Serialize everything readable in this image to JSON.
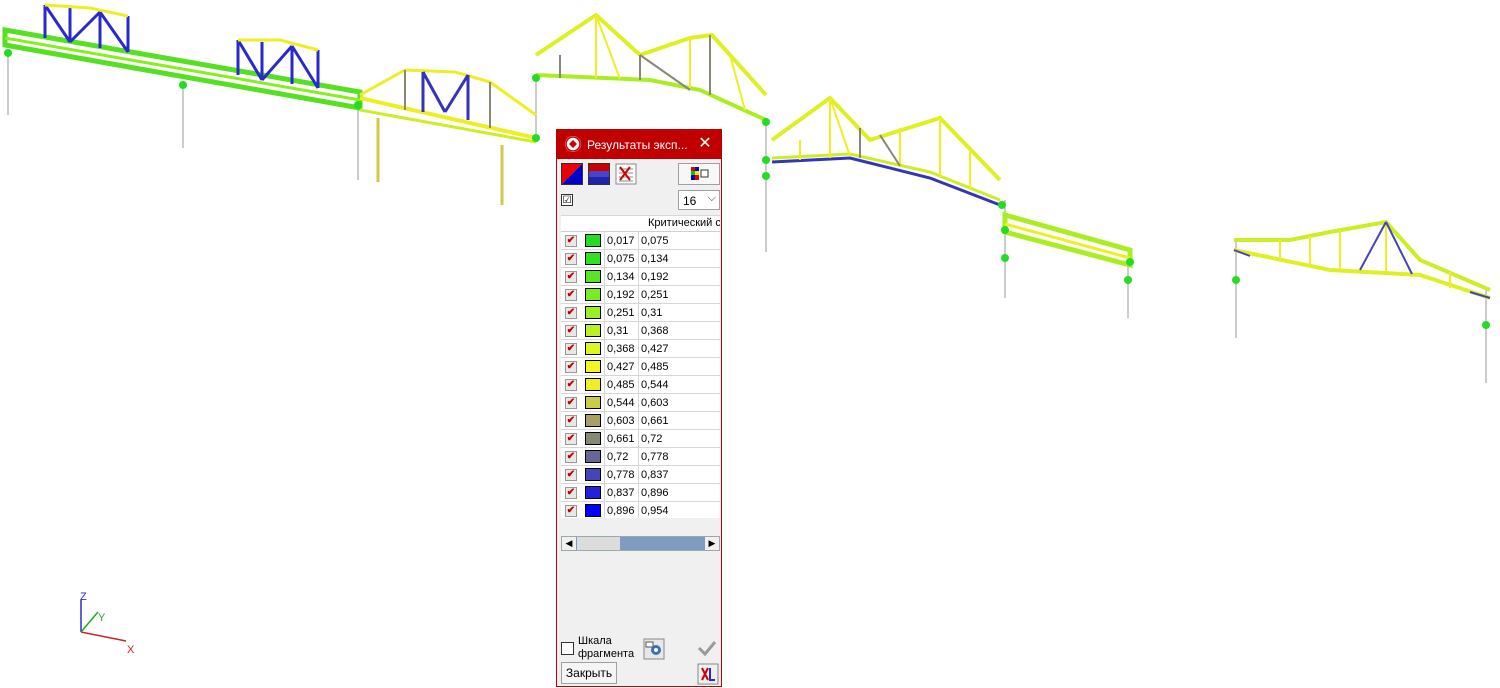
{
  "axes": {
    "x": "X",
    "y": "Y",
    "z": "Z"
  },
  "dialog": {
    "title": "Результаты эксп...",
    "column_header": "Критический с",
    "count_value": "16",
    "check_mark": "☑",
    "scale_label_line1": "Шкала",
    "scale_label_line2": "фрагмента",
    "close_button": "Закрыть",
    "scroll_left": "◀",
    "scroll_right": "▶",
    "dropdown_arrow": "⌵",
    "row_check": "✔",
    "rows": [
      {
        "from": "0,017",
        "to": "0,075",
        "color": "#22dd22"
      },
      {
        "from": "0,075",
        "to": "0,134",
        "color": "#33e022"
      },
      {
        "from": "0,134",
        "to": "0,192",
        "color": "#55e822"
      },
      {
        "from": "0,192",
        "to": "0,251",
        "color": "#77ee22"
      },
      {
        "from": "0,251",
        "to": "0,31",
        "color": "#99f022"
      },
      {
        "from": "0,31",
        "to": "0,368",
        "color": "#bbf022"
      },
      {
        "from": "0,368",
        "to": "0,427",
        "color": "#ddf522"
      },
      {
        "from": "0,427",
        "to": "0,485",
        "color": "#f5f522"
      },
      {
        "from": "0,485",
        "to": "0,544",
        "color": "#eeee22"
      },
      {
        "from": "0,544",
        "to": "0,603",
        "color": "#cccc44"
      },
      {
        "from": "0,603",
        "to": "0,661",
        "color": "#aaa066"
      },
      {
        "from": "0,661",
        "to": "0,72",
        "color": "#888877"
      },
      {
        "from": "0,72",
        "to": "0,778",
        "color": "#666699"
      },
      {
        "from": "0,778",
        "to": "0,837",
        "color": "#4444bb"
      },
      {
        "from": "0,837",
        "to": "0,896",
        "color": "#2222dd"
      },
      {
        "from": "0,896",
        "to": "0,954",
        "color": "#0000ff"
      }
    ]
  },
  "colors": {
    "accent": "#c00000",
    "low": "#22dd22",
    "mid": "#eeee22",
    "high": "#0000ff"
  }
}
